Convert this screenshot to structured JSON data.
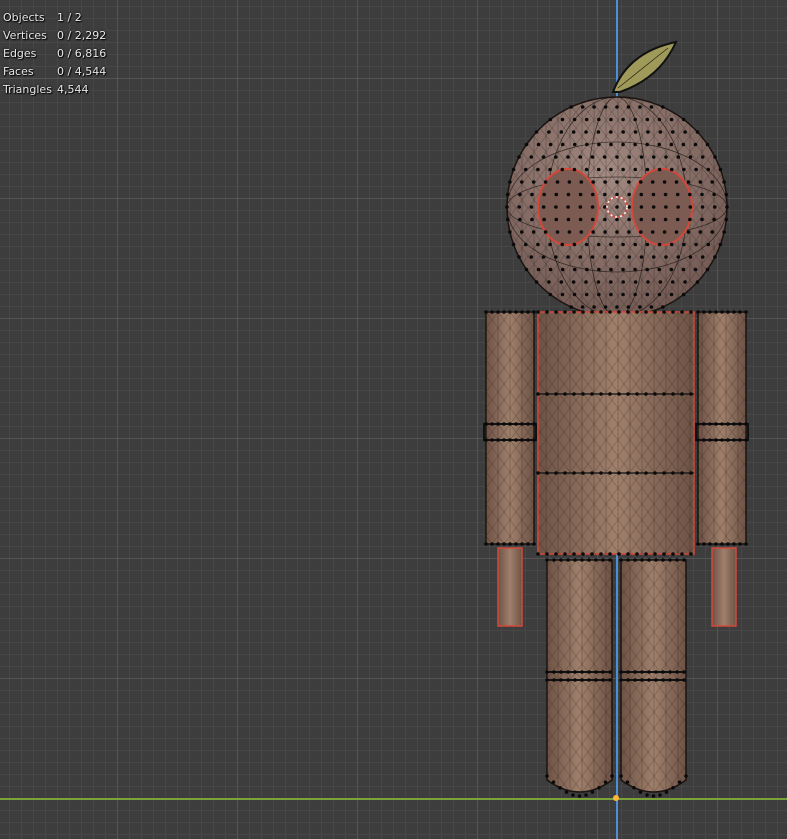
{
  "overlay": {
    "stats": [
      {
        "label": "Objects",
        "value": "1 / 2"
      },
      {
        "label": "Vertices",
        "value": "0 / 2,292"
      },
      {
        "label": "Edges",
        "value": "0 / 6,816"
      },
      {
        "label": "Faces",
        "value": "0 / 4,544"
      },
      {
        "label": "Triangles",
        "value": "4,544"
      }
    ]
  },
  "colors": {
    "background": "#3d3d3d",
    "grid_minor": "#484848",
    "grid_major": "#5f5f5f",
    "z_axis": "#4d8fd6",
    "y_axis": "#7aa33a",
    "mesh_fill": "#8e7160",
    "wire": "#1b1411",
    "seam": "#d3483a",
    "vertex": "#0a0a0a",
    "origin": "#ffb43a",
    "leaf_fill": "#a09a5a"
  },
  "icons": {
    "origin": "origin-point-icon",
    "cursor": "3d-cursor-icon"
  }
}
